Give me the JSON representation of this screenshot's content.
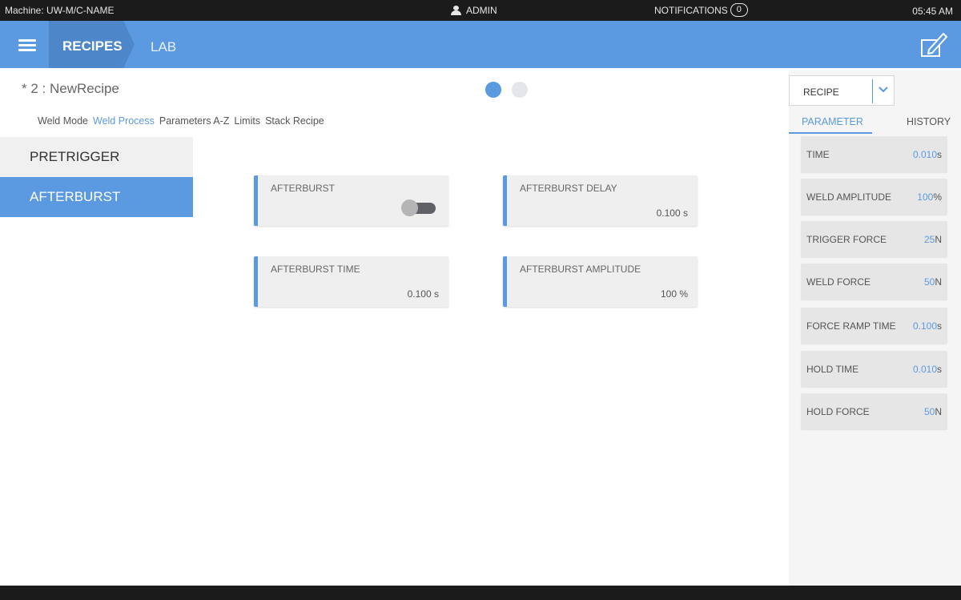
{
  "status_bar": {
    "machine": "Machine: UW-M/C-NAME",
    "user": "ADMIN",
    "notifications_label": "NOTIFICATIONS",
    "notifications_count": "0",
    "time": "05:45 AM"
  },
  "header": {
    "breadcrumb_active": "RECIPES",
    "breadcrumb_next": "LAB",
    "icons": [
      "menu-icon",
      "edit-icon"
    ]
  },
  "recipe": {
    "title": "* 2 : NewRecipe",
    "tabs": [
      "Weld Mode",
      "Weld Process",
      "Parameters A-Z",
      "Limits",
      "Stack Recipe"
    ],
    "active_tab": "Weld Process"
  },
  "side_menu": {
    "items": [
      "PRETRIGGER",
      "AFTERBURST"
    ],
    "active": "AFTERBURST"
  },
  "cards": {
    "afterburst": {
      "label": "AFTERBURST",
      "toggle_on": false
    },
    "afterburst_delay": {
      "label": "AFTERBURST DELAY",
      "value": "0.100 s"
    },
    "afterburst_time": {
      "label": "AFTERBURST TIME",
      "value": "0.100 s"
    },
    "afterburst_amplitude": {
      "label": "AFTERBURST AMPLITUDE",
      "value": "100 %"
    }
  },
  "right_panel": {
    "select_value": "RECIPE",
    "tabs": [
      "PARAMETER",
      "HISTORY"
    ],
    "params": [
      {
        "label": "TIME",
        "value": "0.010",
        "unit": "s"
      },
      {
        "label": "WELD AMPLITUDE",
        "value": "100",
        "unit": "%"
      },
      {
        "label": "TRIGGER FORCE",
        "value": "25",
        "unit": "N"
      },
      {
        "label": "WELD FORCE",
        "value": "50",
        "unit": "N"
      },
      {
        "label": "FORCE RAMP TIME",
        "value": "0.100",
        "unit": "s"
      },
      {
        "label": "HOLD TIME",
        "value": "0.010",
        "unit": "s"
      },
      {
        "label": "HOLD FORCE",
        "value": "50",
        "unit": "N"
      }
    ]
  },
  "colors": {
    "accent": "#5b9ae0",
    "accent_dark": "#4d87ca",
    "status_bar": "#1b1b1b"
  }
}
